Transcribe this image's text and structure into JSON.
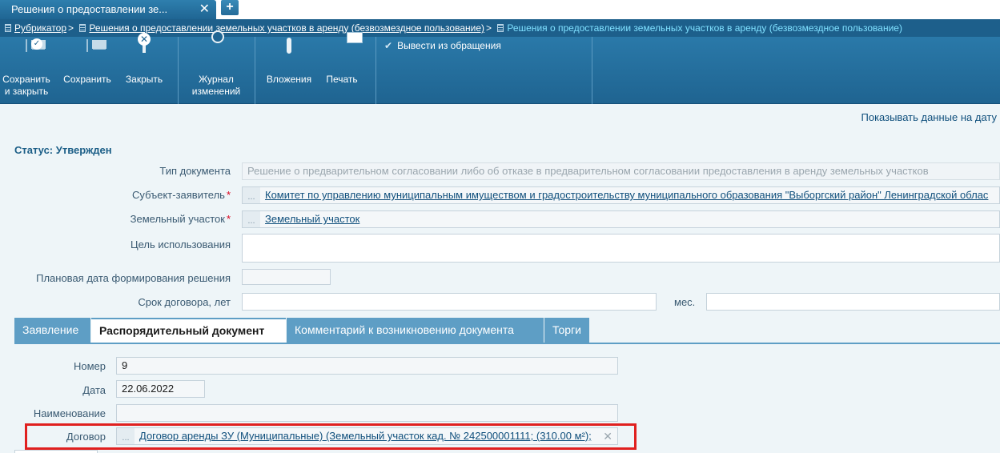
{
  "tab": {
    "title": "Решения о предоставлении зе...",
    "close_glyph": "✕",
    "add_glyph": "+"
  },
  "breadcrumb": {
    "items": [
      "Рубрикатор",
      "Решения о предоставлении земельных участков в аренду (безвозмездное пользование)"
    ],
    "separator": ">",
    "current": "Решения о предоставлении земельных участков в аренду (безвозмездное пользование)"
  },
  "toolbar": {
    "save_close_line1": "Сохранить",
    "save_close_line2": "и закрыть",
    "save": "Сохранить",
    "close": "Закрыть",
    "journal_line1": "Журнал",
    "journal_line2": "изменений",
    "attachments": "Вложения",
    "print": "Печать",
    "withdraw": "Вывести из обращения",
    "withdraw_glyph": "✔"
  },
  "show_data_on_date": "Показывать данные на дату",
  "status": "Статус: Утвержден",
  "form": {
    "doc_type_label": "Тип документа",
    "doc_type_value": "Решение о предварительном согласовании либо об отказе в предварительном согласовании предоставления в аренду земельных участков",
    "applicant_label": "Субъект-заявитель",
    "applicant_value": "Комитет по управлению муниципальным имуществом и градостроительству муниципального образования \"Выборгский район\" Ленинградской облас",
    "land_plot_label": "Земельный участок",
    "land_plot_value": "Земельный участок",
    "purpose_label": "Цель использования",
    "purpose_value": "",
    "planned_date_label": "Плановая дата формирования решения",
    "planned_date_value": "",
    "term_label": "Срок договора, лет",
    "term_value": "",
    "months_label": "мес.",
    "months_value": "",
    "required_mark": "*",
    "ellipsis": "..."
  },
  "tabs": [
    "Заявление",
    "Распорядительный документ",
    "Комментарий к возникновению документа",
    "Торги"
  ],
  "active_tab": "Распорядительный документ",
  "order_doc": {
    "number_label": "Номер",
    "number_value": "9",
    "date_label": "Дата",
    "date_value": "22.06.2022",
    "name_label": "Наименование",
    "name_value": "",
    "contract_label": "Договор",
    "contract_value": "Договор аренды ЗУ (Муниципальные) (Земельный участок кад. № 242500001111; (310.00 м²);",
    "clear_glyph": "✕"
  },
  "colors": {
    "toolbar": "#2a79a9",
    "breadcrumb": "#1d5f8b",
    "tab_inactive": "#5e9ec5",
    "highlight": "#e0201f",
    "link": "#0f4f7c"
  }
}
